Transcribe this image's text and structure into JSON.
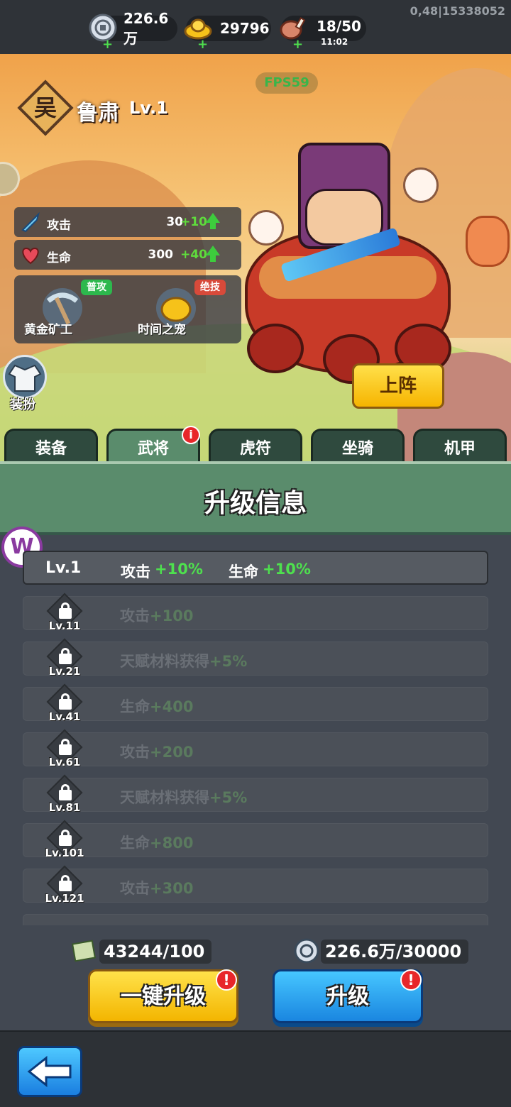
{
  "debug_text": "0,48|15338052",
  "resources": [
    {
      "icon": "silver-coin-icon",
      "value": "226.6万",
      "plus": "+"
    },
    {
      "icon": "gold-ingot-icon",
      "value": "29796",
      "plus": "+"
    },
    {
      "icon": "meat-stamina-icon",
      "value": "18/50",
      "sub": "11:02",
      "plus": "+"
    }
  ],
  "fps": "FPS59",
  "hero": {
    "faction": "吴",
    "name": "鲁肃",
    "level": "Lv.1",
    "stats": [
      {
        "icon": "sword-icon",
        "label": "攻击",
        "value": "30",
        "increase": "+10"
      },
      {
        "icon": "heart-icon",
        "label": "生命",
        "value": "300",
        "increase": "+40"
      }
    ],
    "skills": [
      {
        "icon": "pickaxe-icon",
        "name": "黄金矿工",
        "tag": "普攻",
        "tag_color": "#2db84d"
      },
      {
        "icon": "golden-nugget-icon",
        "name": "时间之宠",
        "tag": "绝技",
        "tag_color": "#d84a3a"
      }
    ],
    "dress_label": "装扮",
    "deploy_label": "上阵"
  },
  "tabs": [
    {
      "label": "装备",
      "active": false
    },
    {
      "label": "武将",
      "active": true,
      "badge": "i"
    },
    {
      "label": "虎符",
      "active": false
    },
    {
      "label": "坐骑",
      "active": false
    },
    {
      "label": "机甲",
      "active": false
    }
  ],
  "panel": {
    "title": "升级信息",
    "current": {
      "level": "Lv.1",
      "attr1_label": "攻击",
      "attr1_value": "+10%",
      "attr2_label": "生命",
      "attr2_value": "+10%"
    },
    "locked": [
      {
        "level": "Lv.11",
        "text": "攻击",
        "value": "+100"
      },
      {
        "level": "Lv.21",
        "text": "天赋材料获得",
        "value": "+5%"
      },
      {
        "level": "Lv.41",
        "text": "生命",
        "value": "+400"
      },
      {
        "level": "Lv.61",
        "text": "攻击",
        "value": "+200"
      },
      {
        "level": "Lv.81",
        "text": "天赋材料获得",
        "value": "+5%"
      },
      {
        "level": "Lv.101",
        "text": "生命",
        "value": "+800"
      },
      {
        "level": "Lv.121",
        "text": "攻击",
        "value": "+300"
      }
    ]
  },
  "costs": {
    "scroll": "43244/100",
    "coins": "226.6万/30000"
  },
  "buttons": {
    "one_click_upgrade": "一键升级",
    "upgrade": "升级",
    "alert": "!"
  },
  "w_logo": "W"
}
